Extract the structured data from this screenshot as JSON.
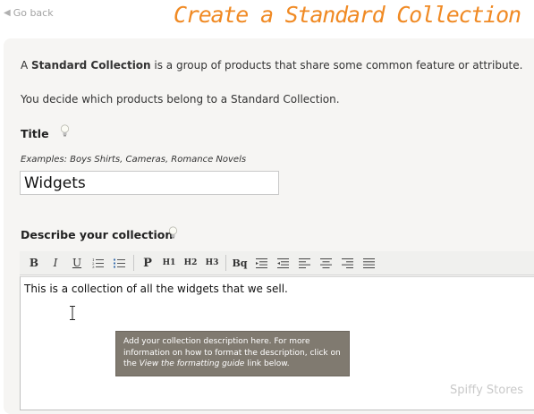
{
  "nav": {
    "back_label": "Go back"
  },
  "page": {
    "title": "Create a Standard Collection"
  },
  "intro": {
    "line1_prefix": "A ",
    "line1_bold": "Standard Collection",
    "line1_suffix": " is a group of products that share some common feature or attribute.",
    "line2": "You decide which products belong to a Standard Collection."
  },
  "title_field": {
    "label": "Title",
    "examples": "Examples: Boys Shirts, Cameras, Romance Novels",
    "value": "Widgets"
  },
  "description": {
    "label": "Describe your collection",
    "text": "This is a collection of all the widgets that we sell."
  },
  "toolbar": {
    "bold": "B",
    "italic": "I",
    "underline": "U",
    "paragraph": "P",
    "h1": "H1",
    "h2": "H2",
    "h3": "H3",
    "blockquote": "Bq"
  },
  "tooltip": {
    "text_before": "Add your collection description here. For more information on how to format the description, click on the ",
    "link_text": "View the formatting guide",
    "text_after": " link below."
  },
  "watermark": "Spiffy Stores"
}
